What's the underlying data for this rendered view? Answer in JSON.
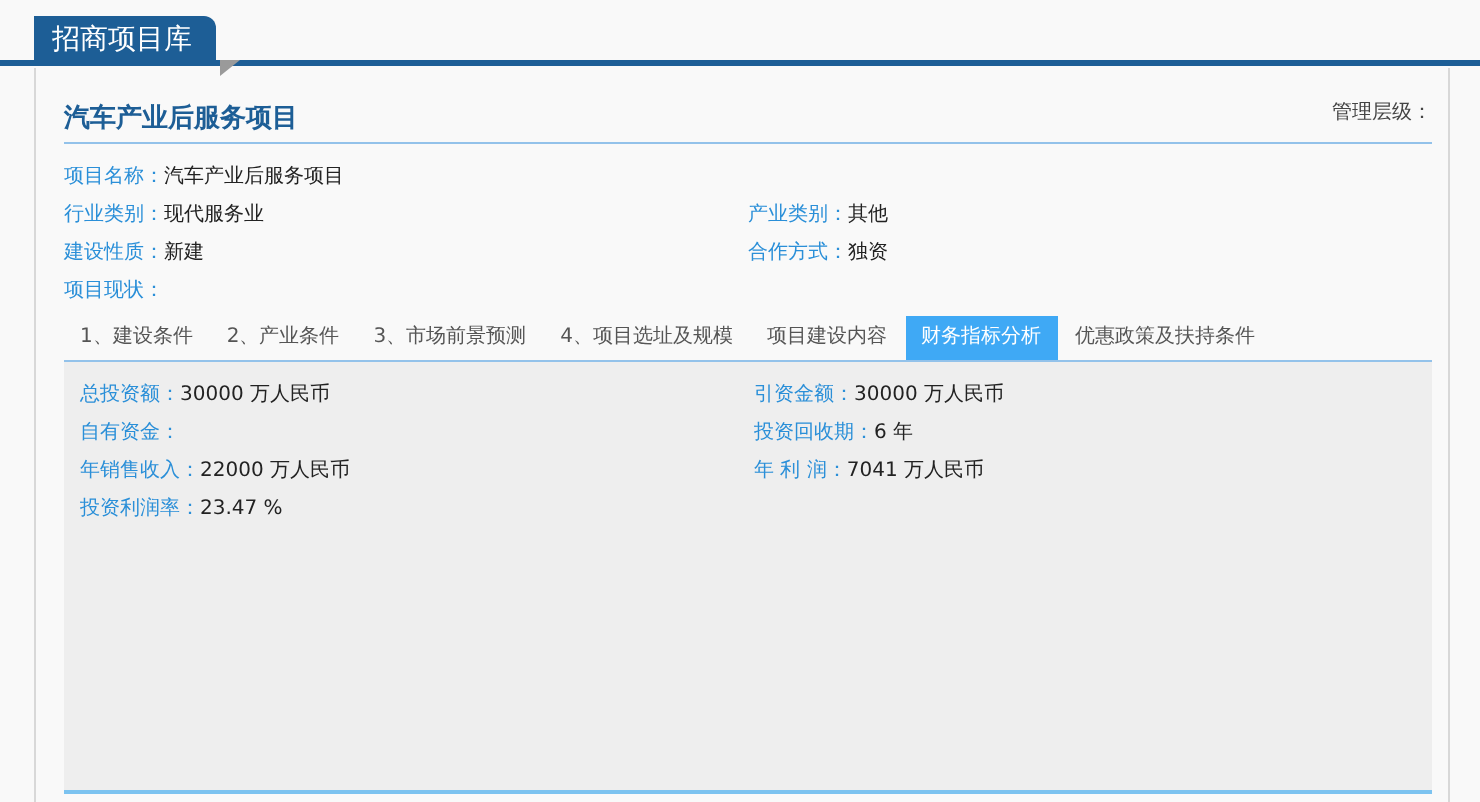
{
  "header": {
    "title": "招商项目库"
  },
  "project": {
    "title": "汽车产业后服务项目",
    "management_level": "管理层级："
  },
  "info_rows": [
    [
      {
        "label": "项目名称：",
        "value": "汽车产业后服务项目"
      }
    ],
    [
      {
        "label": "行业类别：",
        "value": "现代服务业"
      },
      {
        "label": "产业类别：",
        "value": "其他"
      }
    ],
    [
      {
        "label": "建设性质：",
        "value": "新建"
      },
      {
        "label": "合作方式：",
        "value": "独资"
      }
    ],
    [
      {
        "label": "项目现状："
      }
    ]
  ],
  "tabs": [
    {
      "label": "1、建设条件",
      "selected": false
    },
    {
      "label": "2、产业条件",
      "selected": false
    },
    {
      "label": "3、市场前景预测",
      "selected": false
    },
    {
      "label": "4、项目选址及规模",
      "selected": false
    },
    {
      "label": "项目建设内容",
      "selected": false
    },
    {
      "label": "财务指标分析",
      "selected": true
    },
    {
      "label": "优惠政策及扶持条件",
      "selected": false
    }
  ],
  "finance_rows": [
    [
      {
        "label": "总投资额：",
        "value": "30000 万人民币"
      },
      {
        "label": "引资金额：",
        "value": "30000 万人民币"
      }
    ],
    [
      {
        "label": "自有资金："
      },
      {
        "label": "投资回收期：",
        "value": "6 年"
      }
    ],
    [
      {
        "label": "年销售收入：",
        "value": "22000 万人民币"
      },
      {
        "label": "年 利 润：",
        "value": "7041 万人民币"
      }
    ],
    [
      {
        "label": "投资利润率：",
        "value": "23.47 %"
      }
    ]
  ]
}
